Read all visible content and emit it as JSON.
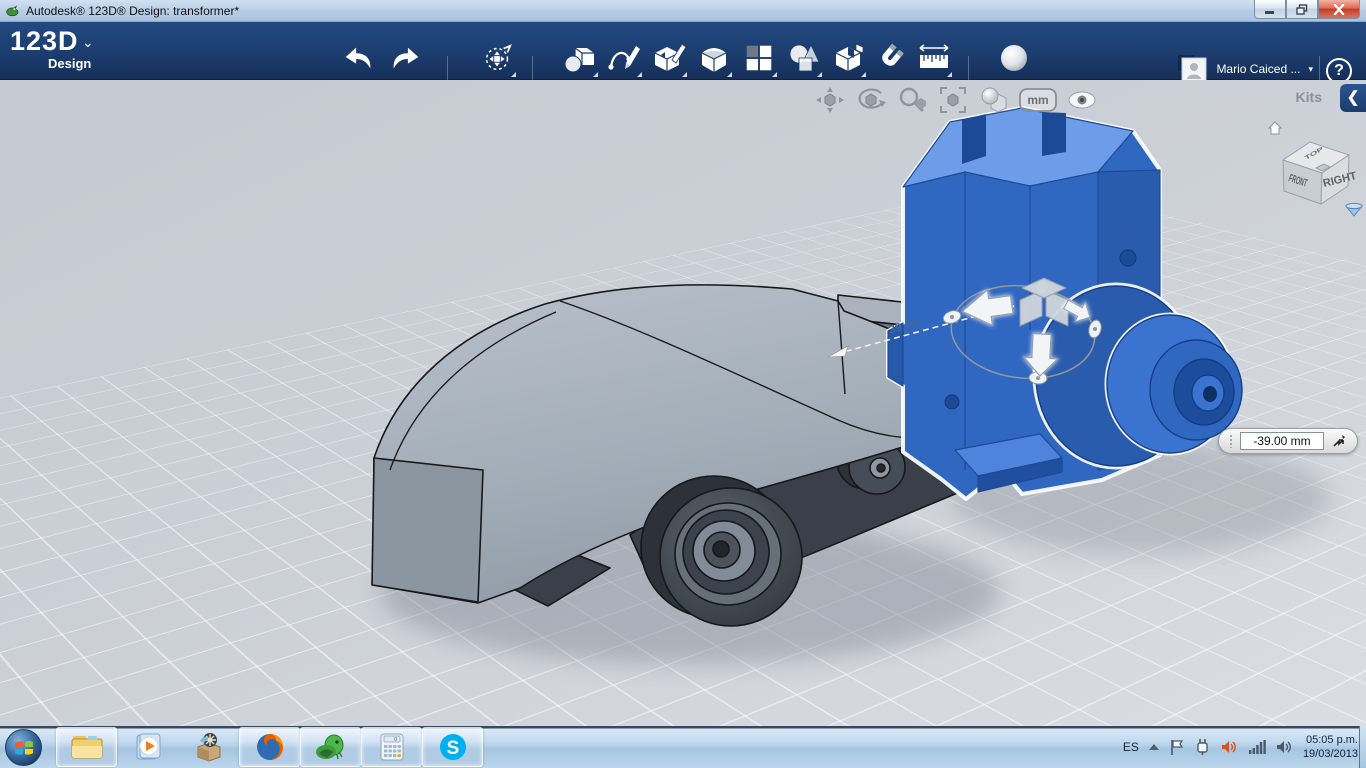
{
  "window": {
    "title": "Autodesk® 123D® Design: transformer*",
    "controls": [
      "minimize",
      "restore",
      "close"
    ]
  },
  "toolbar": {
    "brand": "123D",
    "brand_sub": "Design",
    "tool_icons": [
      "undo",
      "redo",
      "transform",
      "primitives",
      "sketch",
      "construct",
      "modify",
      "pattern",
      "grouping",
      "combine",
      "snap",
      "measure",
      "material-sphere"
    ],
    "user_name": "Mario Caiced ...",
    "help_label": "?"
  },
  "viewport": {
    "nav_icons": [
      "pan",
      "orbit",
      "zoom",
      "fit-view",
      "shading",
      "units",
      "visibility"
    ],
    "units_label": "mm",
    "kits_label": "Kits",
    "viewcube": {
      "top": "TOP",
      "front": "FRONT",
      "right": "RIGHT"
    },
    "dimension_label": "39.00",
    "measure_value": "-39.00 mm"
  },
  "scene": {
    "selected_part_color": "#2f67c1",
    "body_light_gray": "#a8b1bc",
    "chassis_dark_gray": "#3a414b",
    "background": "#c9cdd4"
  },
  "taskbar": {
    "apps": [
      "start",
      "windows-explorer",
      "windows-media-player",
      "boxshot-app",
      "firefox",
      "green-creature-app",
      "calculator",
      "skype"
    ],
    "tray_icons": [
      "language",
      "show-hidden",
      "action-center-flag",
      "power-plug",
      "audio-manager",
      "network-signal",
      "volume"
    ],
    "language": "ES",
    "time": "05:05 p.m.",
    "date": "19/03/2013"
  }
}
